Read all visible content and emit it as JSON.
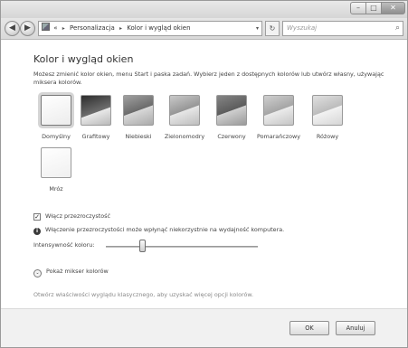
{
  "window": {
    "caption_buttons": {
      "minimize": "–",
      "maximize": "□",
      "close": "✕"
    }
  },
  "navbar": {
    "back_glyph": "◀",
    "forward_glyph": "▶",
    "breadcrumb_prefix": "«",
    "breadcrumbs": [
      "Personalizacja",
      "Kolor i wygląd okien"
    ],
    "breadcrumb_separator": "▸",
    "dropdown_glyph": "▾",
    "refresh_glyph": "↻",
    "search_placeholder": "Wyszukaj",
    "search_icon": "⌕"
  },
  "main": {
    "title": "Kolor i wygląd okien",
    "intro": "Możesz zmienić kolor okien, menu Start i paska zadań. Wybierz jeden z dostępnych kolorów lub utwórz własny, używając miksera kolorów.",
    "swatches": [
      {
        "label": "Domyślny",
        "selected": true
      },
      {
        "label": "Grafitowy",
        "selected": false
      },
      {
        "label": "Niebieski",
        "selected": false
      },
      {
        "label": "Zielonomodry",
        "selected": false
      },
      {
        "label": "Czerwony",
        "selected": false
      },
      {
        "label": "Pomarańczowy",
        "selected": false
      },
      {
        "label": "Różowy",
        "selected": false
      },
      {
        "label": "Mróz",
        "selected": false
      }
    ],
    "transparency": {
      "label": "Włącz przezroczystość",
      "checked": true,
      "check_glyph": "✓"
    },
    "warning": {
      "icon": "i",
      "text": "Włączenie przezroczystości może wpłynąć niekorzystnie na wydajność komputera."
    },
    "intensity": {
      "label": "Intensywność koloru:",
      "level_percent": 24
    },
    "mixer": {
      "label": "Pokaż mikser kolorów",
      "glyph": "⌄"
    },
    "classic_link": "Otwórz właściwości wyglądu klasycznego, aby uzyskać więcej opcji kolorów."
  },
  "footer": {
    "ok_label": "OK",
    "cancel_label": "Anuluj"
  }
}
